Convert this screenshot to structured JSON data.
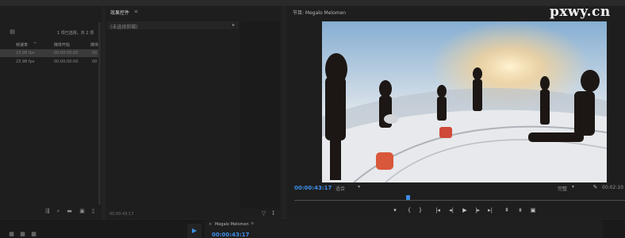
{
  "watermark": "pxwy.cn",
  "project": {
    "selection_count": "1 项已选择，共 2 项",
    "columns": [
      "帧速率",
      "媒体开始",
      "媒体"
    ],
    "rows": [
      {
        "rate": "23.98 fps",
        "start": "00:00:00:00",
        "end": "00"
      },
      {
        "rate": "23.98 fps",
        "start": "00:00:00:00",
        "end": "00"
      }
    ]
  },
  "effects": {
    "title": "效果控件",
    "no_clip": "(未选择剪辑)",
    "time": "00:00:43:17"
  },
  "program": {
    "title": "节目: Megalo Melomen",
    "timecode": "00:00:43:17",
    "fit": "适合",
    "quality": "完整",
    "duration": "00:02:10"
  },
  "timeline": {
    "sequence": "Megalo Melomen",
    "timecode": "00:00:43:17"
  },
  "colors": {
    "accent_blue": "#3d8ee8",
    "panel": "#1e1e1e",
    "frame": "#232323"
  }
}
